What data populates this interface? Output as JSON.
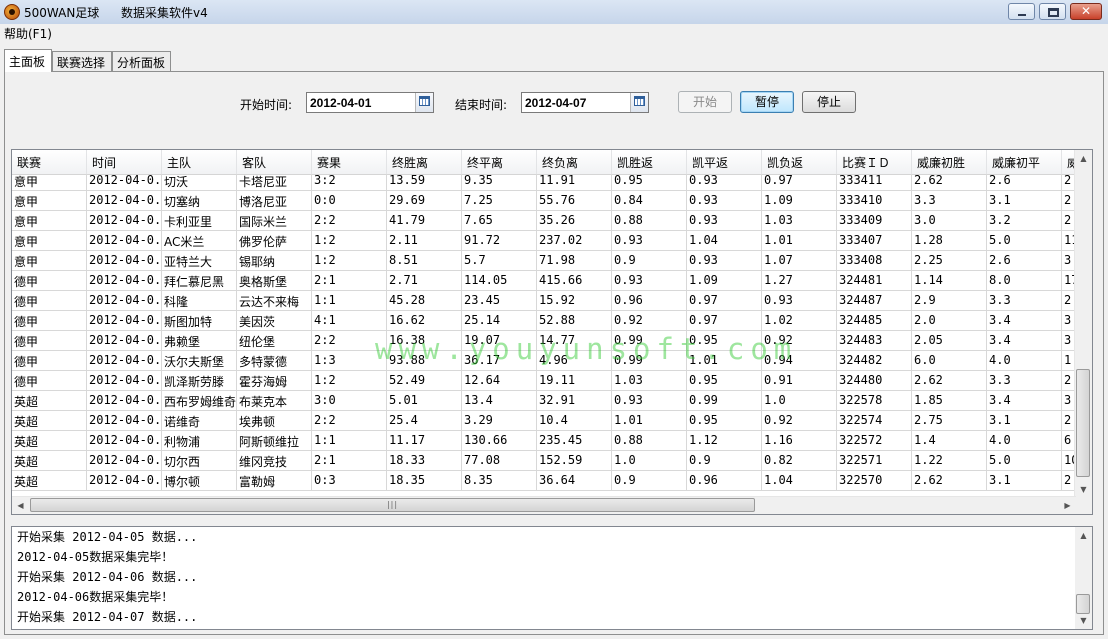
{
  "window": {
    "app_name": "500WAN足球",
    "subtitle": "数据采集软件v4"
  },
  "menu": {
    "help": "帮助(F1)"
  },
  "tabs": [
    {
      "label": "主面板",
      "active": true
    },
    {
      "label": "联赛选择",
      "active": false
    },
    {
      "label": "分析面板",
      "active": false
    }
  ],
  "controls": {
    "start_label": "开始时间:",
    "start_value": "2012-04-01",
    "end_label": "结束时间:",
    "end_value": "2012-04-07",
    "btn_start": "开始",
    "btn_pause": "暂停",
    "btn_stop": "停止"
  },
  "table": {
    "columns": [
      "联赛",
      "时间",
      "主队",
      "客队",
      "赛果",
      "终胜离",
      "终平离",
      "终负离",
      "凯胜返",
      "凯平返",
      "凯负返",
      "比赛ＩＤ",
      "威廉初胜",
      "威廉初平",
      "威"
    ],
    "rows": [
      [
        "意甲",
        "2012-04-0...",
        "切沃",
        "卡塔尼亚",
        "3:2",
        "13.59",
        "9.35",
        "11.91",
        "0.95",
        "0.93",
        "0.97",
        "333411",
        "2.62",
        "2.6",
        "2."
      ],
      [
        "意甲",
        "2012-04-0...",
        "切塞纳",
        "博洛尼亚",
        "0:0",
        "29.69",
        "7.25",
        "55.76",
        "0.84",
        "0.93",
        "1.09",
        "333410",
        "3.3",
        "3.1",
        "2."
      ],
      [
        "意甲",
        "2012-04-0...",
        "卡利亚里",
        "国际米兰",
        "2:2",
        "41.79",
        "7.65",
        "35.26",
        "0.88",
        "0.93",
        "1.03",
        "333409",
        "3.0",
        "3.2",
        "2."
      ],
      [
        "意甲",
        "2012-04-0...",
        "AC米兰",
        "佛罗伦萨",
        "1:2",
        "2.11",
        "91.72",
        "237.02",
        "0.93",
        "1.04",
        "1.01",
        "333407",
        "1.28",
        "5.0",
        "11"
      ],
      [
        "意甲",
        "2012-04-0...",
        "亚特兰大",
        "锡耶纳",
        "1:2",
        "8.51",
        "5.7",
        "71.98",
        "0.9",
        "0.93",
        "1.07",
        "333408",
        "2.25",
        "2.6",
        "3."
      ],
      [
        "德甲",
        "2012-04-0...",
        "拜仁慕尼黑",
        "奥格斯堡",
        "2:1",
        "2.71",
        "114.05",
        "415.66",
        "0.93",
        "1.09",
        "1.27",
        "324481",
        "1.14",
        "8.0",
        "17"
      ],
      [
        "德甲",
        "2012-04-0...",
        "科隆",
        "云达不来梅",
        "1:1",
        "45.28",
        "23.45",
        "15.92",
        "0.96",
        "0.97",
        "0.93",
        "324487",
        "2.9",
        "3.3",
        "2."
      ],
      [
        "德甲",
        "2012-04-0...",
        "斯图加特",
        "美因茨",
        "4:1",
        "16.62",
        "25.14",
        "52.88",
        "0.92",
        "0.97",
        "1.02",
        "324485",
        "2.0",
        "3.4",
        "3."
      ],
      [
        "德甲",
        "2012-04-0...",
        "弗赖堡",
        "纽伦堡",
        "2:2",
        "16.38",
        "19.07",
        "14.77",
        "0.99",
        "0.95",
        "0.92",
        "324483",
        "2.05",
        "3.4",
        "3."
      ],
      [
        "德甲",
        "2012-04-0...",
        "沃尔夫斯堡",
        "多特蒙德",
        "1:3",
        "93.88",
        "36.17",
        "4.96",
        "0.99",
        "1.01",
        "0.94",
        "324482",
        "6.0",
        "4.0",
        "1."
      ],
      [
        "德甲",
        "2012-04-0...",
        "凯泽斯劳滕",
        "霍芬海姆",
        "1:2",
        "52.49",
        "12.64",
        "19.11",
        "1.03",
        "0.95",
        "0.91",
        "324480",
        "2.62",
        "3.3",
        "2."
      ],
      [
        "英超",
        "2012-04-0...",
        "西布罗姆维奇",
        "布莱克本",
        "3:0",
        "5.01",
        "13.4",
        "32.91",
        "0.93",
        "0.99",
        "1.0",
        "322578",
        "1.85",
        "3.4",
        "3."
      ],
      [
        "英超",
        "2012-04-0...",
        "诺维奇",
        "埃弗顿",
        "2:2",
        "25.4",
        "3.29",
        "10.4",
        "1.01",
        "0.95",
        "0.92",
        "322574",
        "2.75",
        "3.1",
        "2."
      ],
      [
        "英超",
        "2012-04-0...",
        "利物浦",
        "阿斯顿维拉",
        "1:1",
        "11.17",
        "130.66",
        "235.45",
        "0.88",
        "1.12",
        "1.16",
        "322572",
        "1.4",
        "4.0",
        "6."
      ],
      [
        "英超",
        "2012-04-0...",
        "切尔西",
        "维冈竞技",
        "2:1",
        "18.33",
        "77.08",
        "152.59",
        "1.0",
        "0.9",
        "0.82",
        "322571",
        "1.22",
        "5.0",
        "10"
      ],
      [
        "英超",
        "2012-04-0...",
        "博尔顿",
        "富勒姆",
        "0:3",
        "18.35",
        "8.35",
        "36.64",
        "0.9",
        "0.96",
        "1.04",
        "322570",
        "2.62",
        "3.1",
        "2."
      ]
    ]
  },
  "watermark": "www.youyunsoft.com",
  "log": [
    "开始采集 2012-04-05 数据...",
    "2012-04-05数据采集完毕！",
    "开始采集 2012-04-06 数据...",
    "2012-04-06数据采集完毕！",
    "开始采集 2012-04-07 数据..."
  ],
  "icons": {
    "app": "football-icon",
    "calendar": "calendar-icon",
    "minimize": "minimize-icon",
    "maximize": "maximize-icon",
    "close": "close-icon"
  },
  "colors": {
    "titlebar": "#c6d5ea",
    "close_button": "#c8412a",
    "watermark": "#28c828"
  }
}
